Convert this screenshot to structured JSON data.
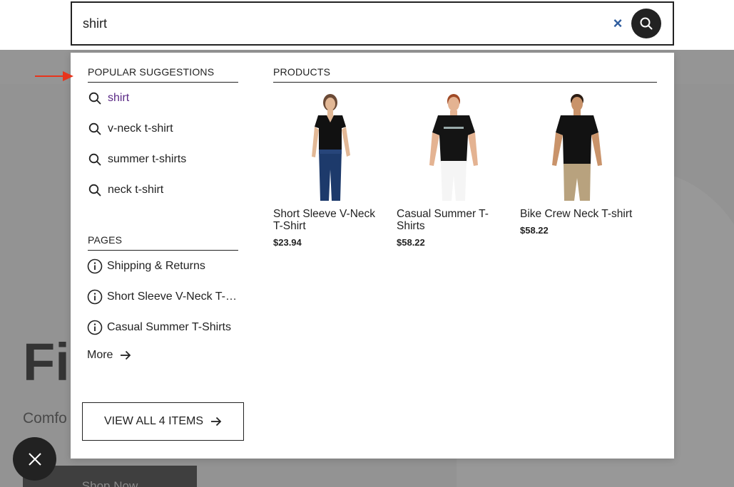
{
  "search": {
    "value": "shirt",
    "clear_label": "×"
  },
  "suggestions": {
    "title": "POPULAR SUGGESTIONS",
    "items": [
      {
        "label": "shirt"
      },
      {
        "label": "v-neck t-shirt"
      },
      {
        "label": "summer t-shirts"
      },
      {
        "label": "neck t-shirt"
      }
    ]
  },
  "pages": {
    "title": "PAGES",
    "items": [
      {
        "label": "Shipping & Returns"
      },
      {
        "label": "Short Sleeve V-Neck T-Shirt"
      },
      {
        "label": "Casual Summer T-Shirts"
      }
    ],
    "more_label": "More"
  },
  "view_all_label": "VIEW ALL 4 ITEMS",
  "products": {
    "title": "PRODUCTS",
    "items": [
      {
        "name": "Short Sleeve V-Neck T-Shirt",
        "price": "$23.94"
      },
      {
        "name": "Casual Summer T-Shirts",
        "price": "$58.22"
      },
      {
        "name": "Bike Crew Neck T-shirt",
        "price": "$58.22"
      }
    ]
  },
  "background": {
    "hero_title": "Fi",
    "hero_subtitle": "Comfo",
    "hero_button": "Shop Now"
  },
  "colors": {
    "accent": "#2f5d9e",
    "active_suggestion": "#5b2a86",
    "annotation_arrow": "#e8341c"
  }
}
